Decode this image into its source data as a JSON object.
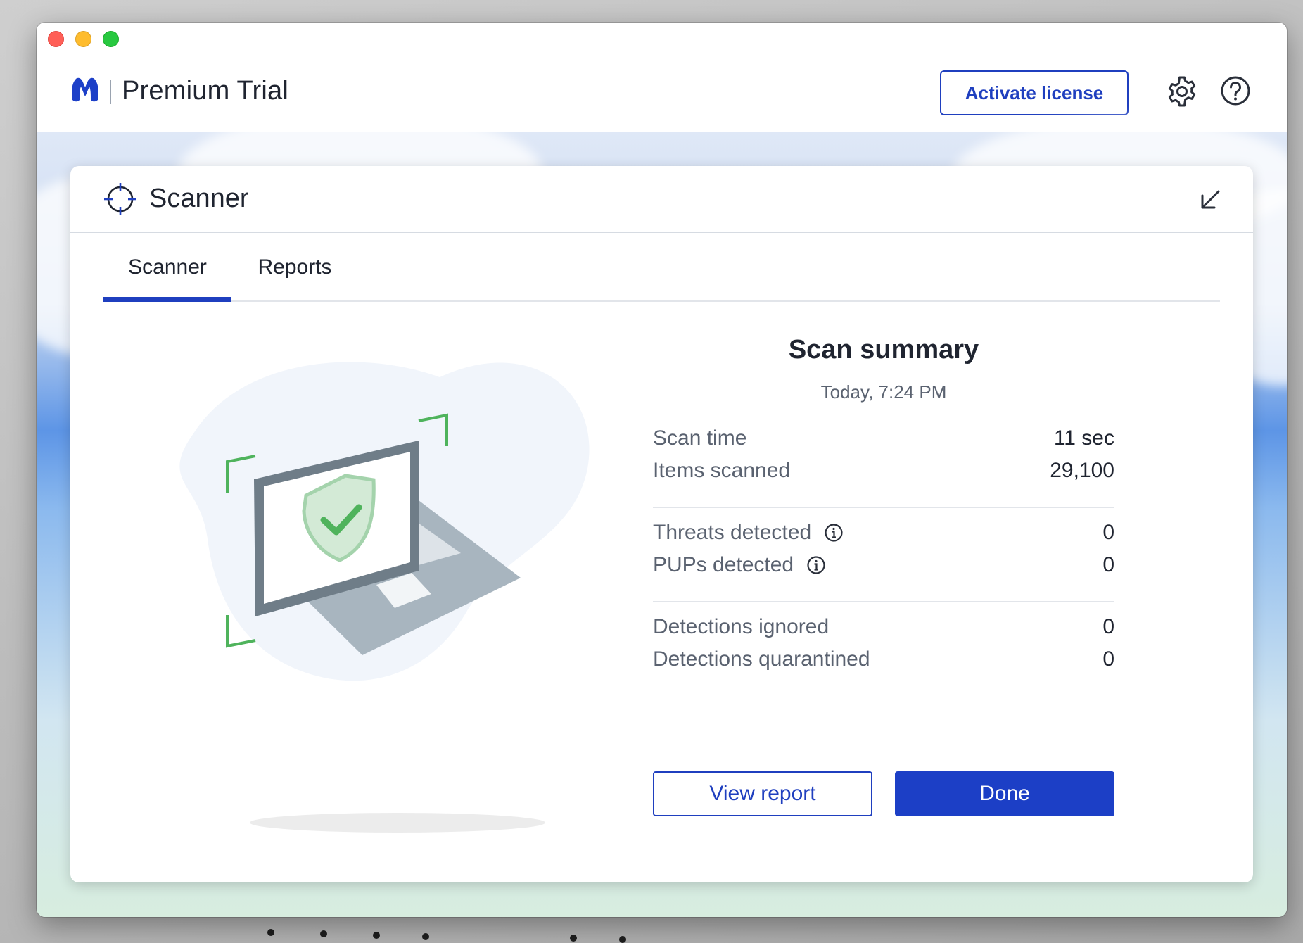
{
  "header": {
    "title": "Premium Trial",
    "activate_label": "Activate license",
    "settings_icon": "gear-icon",
    "help_icon": "help-icon",
    "logo_icon": "malwarebytes-logo"
  },
  "panel": {
    "title": "Scanner",
    "title_icon": "crosshair-icon",
    "collapse_icon": "collapse-arrow-icon",
    "tabs": [
      {
        "label": "Scanner",
        "active": true
      },
      {
        "label": "Reports",
        "active": false
      }
    ]
  },
  "summary": {
    "title": "Scan summary",
    "date": "Today, 7:24 PM",
    "rows": [
      {
        "label": "Scan time",
        "value": "11 sec"
      },
      {
        "label": "Items scanned",
        "value": "29,100"
      },
      {
        "label": "Threats detected",
        "value": "0"
      },
      {
        "label": "PUPs detected",
        "value": "0"
      },
      {
        "label": "Detections ignored",
        "value": "0"
      },
      {
        "label": "Detections quarantined",
        "value": "0"
      }
    ],
    "view_report_label": "View report",
    "done_label": "Done"
  },
  "colors": {
    "accent": "#1f3fbf",
    "shield_green": "#4fb35c"
  }
}
